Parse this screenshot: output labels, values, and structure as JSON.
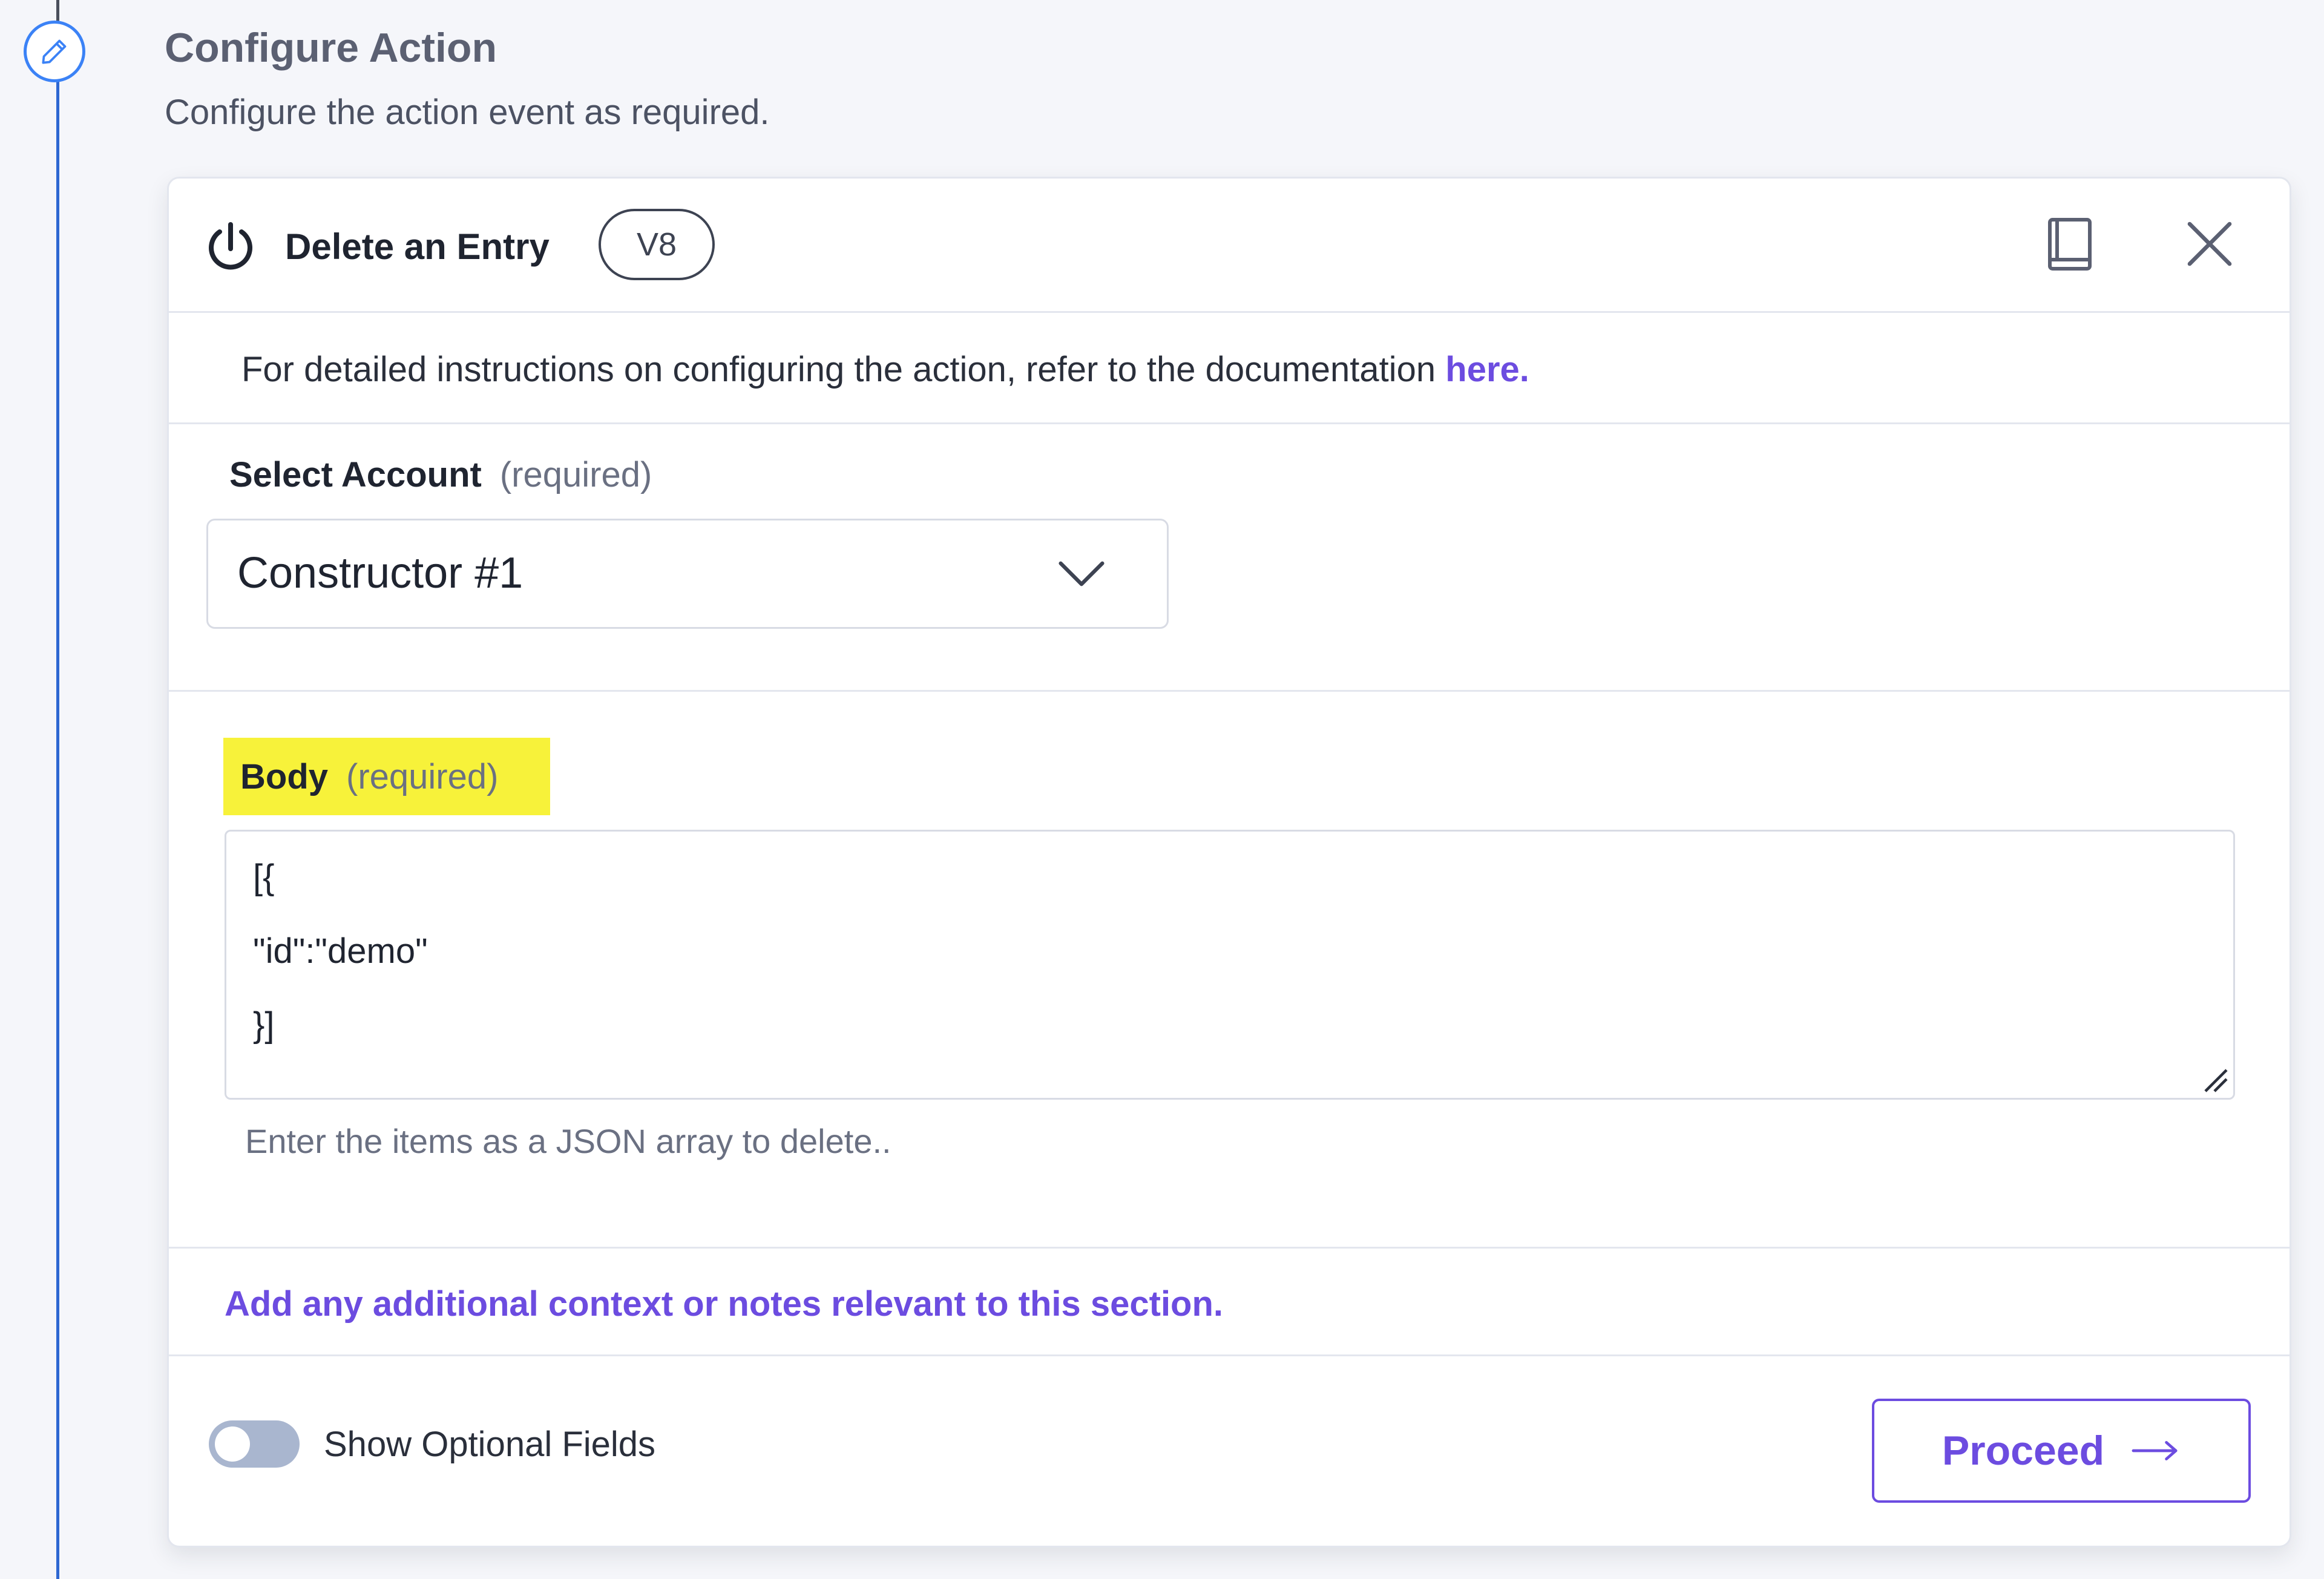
{
  "step": {
    "title": "Configure Action",
    "subtitle": "Configure the action event as required."
  },
  "action": {
    "name": "Delete an Entry",
    "version": "V8"
  },
  "instructions": {
    "text": "For detailed instructions on configuring the action, refer to the documentation ",
    "link_label": "here."
  },
  "account": {
    "label": "Select Account",
    "required_text": "(required)",
    "selected_value": "Constructor #1"
  },
  "body": {
    "label": "Body",
    "required_text": "(required)",
    "lines": [
      "[{",
      "\"id\":\"demo\"",
      "}]"
    ],
    "help_text": "Enter the items as a JSON array to delete.."
  },
  "notes": {
    "link_label": "Add any additional context or notes relevant to this section."
  },
  "footer": {
    "toggle_label": "Show Optional Fields",
    "toggle_on": false,
    "proceed_label": "Proceed"
  },
  "colors": {
    "accent": "#6c4ce0",
    "timeline": "#2e67d2",
    "highlight": "#f7f23a"
  }
}
